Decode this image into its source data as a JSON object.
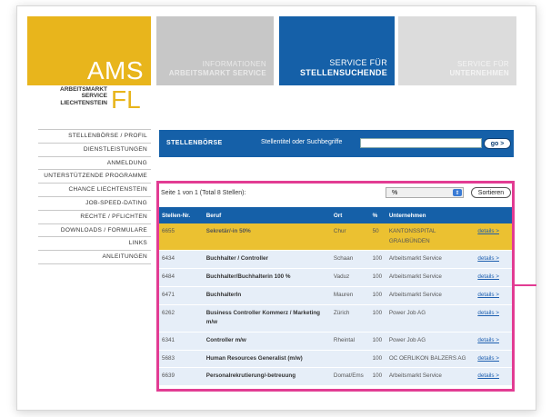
{
  "logo": {
    "ams": "AMS",
    "sub_line1": "ARBEITSMARKT",
    "sub_line2": "SERVICE",
    "sub_line3": "LIECHTENSTEIN",
    "fl": "FL"
  },
  "nav": [
    {
      "line1": "INFORMATIONEN",
      "line2": "ARBEITSMARKT SERVICE"
    },
    {
      "line1": "SERVICE FÜR",
      "line2": "STELLENSUCHENDE"
    },
    {
      "line1": "SERVICE FÜR",
      "line2": "UNTERNEHMEN"
    }
  ],
  "sidebar": {
    "items": [
      "STELLENBÖRSE / PROFIL",
      "DIENSTLEISTUNGEN",
      "ANMELDUNG",
      "UNTERSTÜTZENDE PROGRAMME",
      "CHANCE LIECHTENSTEIN",
      "JOB-SPEED-DATING",
      "RECHTE / PFLICHTEN",
      "DOWNLOADS / FORMULARE",
      "LINKS",
      "ANLEITUNGEN"
    ]
  },
  "search": {
    "title": "STELLENBÖRSE",
    "label": "Stellentitel oder Suchbegriffe",
    "value": "",
    "go_label": "go >"
  },
  "results": {
    "info": "Seite 1 von 1 (Total 8 Stellen):",
    "filter_value": "%",
    "sort_label": "Sortieren",
    "columns": [
      "Stellen-Nr.",
      "Beruf",
      "Ort",
      "%",
      "Unternehmen",
      ""
    ],
    "rows": [
      {
        "nr": "6655",
        "beruf": "Sekretär/-in 50%",
        "ort": "Chur",
        "pct": "50",
        "firma": "KANTONSSPITAL GRAUBÜNDEN",
        "details": "details >"
      },
      {
        "nr": "6434",
        "beruf": "Buchhalter / Controller",
        "ort": "Schaan",
        "pct": "100",
        "firma": "Arbeitsmarkt Service",
        "details": "details >"
      },
      {
        "nr": "6484",
        "beruf": "Buchhalter/Buchhalterin 100 %",
        "ort": "Vaduz",
        "pct": "100",
        "firma": "Arbeitsmarkt Service",
        "details": "details >"
      },
      {
        "nr": "6471",
        "beruf": "BuchhalterIn",
        "ort": "Mauren",
        "pct": "100",
        "firma": "Arbeitsmarkt Service",
        "details": "details >"
      },
      {
        "nr": "6262",
        "beruf": "Business Controller Kommerz / Marketing m/w",
        "ort": "Zürich",
        "pct": "100",
        "firma": "Power Job AG",
        "details": "details >"
      },
      {
        "nr": "6341",
        "beruf": "Controller m/w",
        "ort": "Rheintal",
        "pct": "100",
        "firma": "Power Job AG",
        "details": "details >"
      },
      {
        "nr": "5683",
        "beruf": "Human Resources Generalist (m/w)",
        "ort": "",
        "pct": "100",
        "firma": "OC OERLIKON BALZERS AG",
        "details": "details >"
      },
      {
        "nr": "6639",
        "beruf": "Personalrekrutierung/-betreuung",
        "ort": "Domat/Ems",
        "pct": "100",
        "firma": "Arbeitsmarkt Service",
        "details": "details >"
      }
    ]
  },
  "colors": {
    "blue": "#1560a8",
    "yellow": "#e8b51c",
    "highlight_pink": "#e23c93"
  }
}
